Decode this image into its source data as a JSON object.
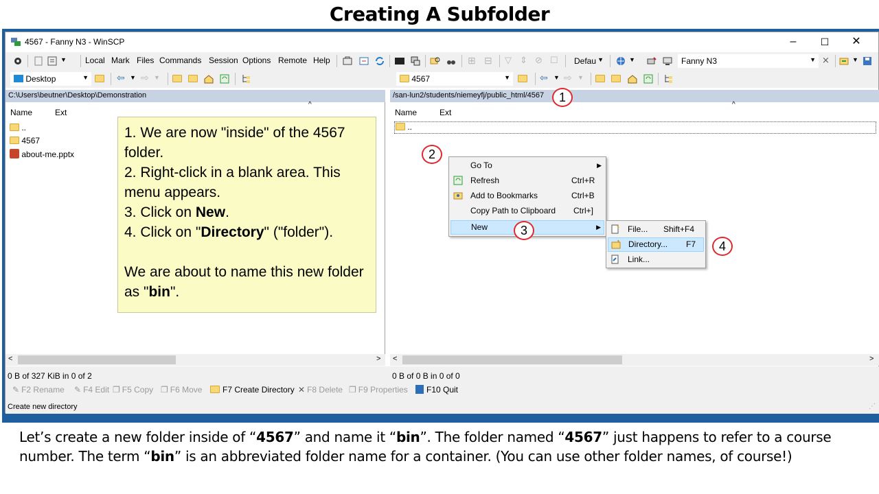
{
  "slide_title": "Creating A Subfolder",
  "window": {
    "title": "4567 - Fanny N3 - WinSCP",
    "min_glyph": "–",
    "max_glyph": "☐",
    "close_glyph": "✕"
  },
  "menu": [
    "Local",
    "Mark",
    "Files",
    "Commands",
    "Session",
    "Options",
    "Remote",
    "Help"
  ],
  "toolbar": {
    "transfer_preset": "Defau",
    "session_combo": "Fanny N3"
  },
  "left_panel": {
    "location": "Desktop",
    "path": "C:\\Users\\beutner\\Desktop\\Demonstration",
    "col_name": "Name",
    "col_ext": "Ext",
    "files": [
      "..",
      "4567",
      "about-me.pptx"
    ],
    "status": "0 B of 327 KiB in 0 of 2"
  },
  "right_panel": {
    "location": "4567",
    "path": "/san-lun2/students/niemeyfj/public_html/4567",
    "col_name": "Name",
    "col_ext": "Ext",
    "files": [
      ".."
    ],
    "status": "0 B of 0 B in 0 of 0"
  },
  "note": {
    "line1": "1. We are now \"inside\" of the 4567 folder.",
    "line2": "2. Right-click in a blank area. This menu appears.",
    "line3_pre": "3. Click on ",
    "line3_bold": "New",
    "line3_post": ".",
    "line4_pre": "4. Click on \"",
    "line4_bold": "Directory",
    "line4_post": "\" (\"folder\").",
    "line5_pre": "We are about to name this new folder as \"",
    "line5_bold": "bin",
    "line5_post": "\"."
  },
  "context_menu": [
    {
      "label": "Go To",
      "shortcut": "",
      "submenu": true
    },
    {
      "label": "Refresh",
      "shortcut": "Ctrl+R",
      "submenu": false
    },
    {
      "label": "Add to Bookmarks",
      "shortcut": "Ctrl+B",
      "submenu": false
    },
    {
      "label": "Copy Path to Clipboard",
      "shortcut": "Ctrl+]",
      "submenu": false
    },
    {
      "label": "New",
      "shortcut": "",
      "submenu": true
    }
  ],
  "submenu": [
    {
      "label": "File...",
      "shortcut": "Shift+F4"
    },
    {
      "label": "Directory...",
      "shortcut": "F7"
    },
    {
      "label": "Link...",
      "shortcut": ""
    }
  ],
  "callouts": [
    "1",
    "2",
    "3",
    "4"
  ],
  "function_keys": [
    {
      "label": "F2 Rename",
      "enabled": false
    },
    {
      "label": "F4 Edit",
      "enabled": false
    },
    {
      "label": "F5 Copy",
      "enabled": false
    },
    {
      "label": "F6 Move",
      "enabled": false
    },
    {
      "label": "F7 Create Directory",
      "enabled": true
    },
    {
      "label": "F8 Delete",
      "enabled": false
    },
    {
      "label": "F9 Properties",
      "enabled": false
    },
    {
      "label": "F10 Quit",
      "enabled": true
    }
  ],
  "status_hint": "Create new directory",
  "caption": {
    "p1": "Let’s create a new folder inside of “",
    "b1": "4567",
    "p2": "” and name it “",
    "b2": "bin",
    "p3": "”.  The folder named “",
    "b3": "4567",
    "p4": "” just happens to refer to a course number. The term “",
    "b4": "bin",
    "p5": "” is an abbreviated folder name for a container. (You can use other folder names, of course!)"
  }
}
